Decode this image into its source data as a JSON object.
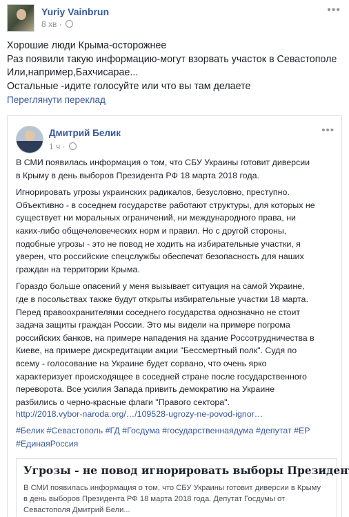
{
  "post": {
    "author": "Yuriy Vainbrun",
    "time": "8 хв",
    "more_label": "•••",
    "lines": [
      "Хорошие люди Крыма-осторожнее",
      "Раз появили такую информацию-могут взорвать участок в Севастополе",
      "Или,например,Бахчисарае...",
      "Остальные -идите голосуйте или что вы там делаете"
    ],
    "translate_label": "Переглянути переклад"
  },
  "shared": {
    "author": "Дмитрий Белик",
    "time": "1 ч",
    "more_label": "•••",
    "paragraphs": [
      [
        "В СМИ появилась информация о том, что СБУ Украины готовит диверсии",
        "в Крыму в день выборов Президента РФ 18 марта 2018 года."
      ],
      [
        "Игнорировать угрозы украинских радикалов, безусловно, преступно.",
        "Объективно - в соседнем государстве работают структуры, для которых не",
        "существует ни моральных ограничений, ни международного права, ни",
        "каких-либо общечеловеческих норм и правил. Но с другой стороны,",
        "подобные угрозы - это не повод не ходить на избирательные участки, я",
        "уверен, что российские спецслужбы обеспечат безопасность для наших",
        "граждан на территории Крыма."
      ],
      [
        "Гораздо больше опасений у меня вызывает ситуация на самой Украине,",
        "где в посольствах также будут открыты избирательные участки 18 марта.",
        "Перед правоохранителями соседнего государства однозначно не стоит",
        "задача защиты граждан России. Это мы видели на примере погрома",
        "российских банков, на примере нападения на здание Россотрудничества в",
        "Киеве, на примере дискредитации акции \"Бессмертный полк\". Судя по",
        "всему - голосование на Украине будет сорвано, что очень ярко",
        "характеризует происходящее в соседней стране после государственного",
        "переворота. Все усилия Запада привить демократию на Украине",
        "разбились о черно-красные флаги \"Правого сектора\"."
      ]
    ],
    "link": "http://2018.vybor-naroda.org/…/109528-ugrozy-ne-povod-ignor…",
    "hashtags_lines": [
      "#Белик #Севастополь #ГД #Госдума #государственнаядума #депутат #ЕР",
      "#ЕдинаяРоссия"
    ],
    "card": {
      "title": "Угрозы - не повод игнорировать выборы Президента!",
      "description_lines": [
        "В СМИ появилась информация о том, что СБУ Украины готовит диверсии в Крыму",
        "в день выборов Президента РФ 18 марта 2018 года. Депутат Госдумы от",
        "Севастополя Дмитрий Бели..."
      ]
    }
  },
  "icons": {
    "post_avatar": "user-photo",
    "privacy": "globe-icon",
    "shared_avatar": "user-photo"
  },
  "colors": {
    "link": "#365899",
    "text": "#1d2129",
    "muted": "#90949c",
    "border": "#dddfe2"
  }
}
